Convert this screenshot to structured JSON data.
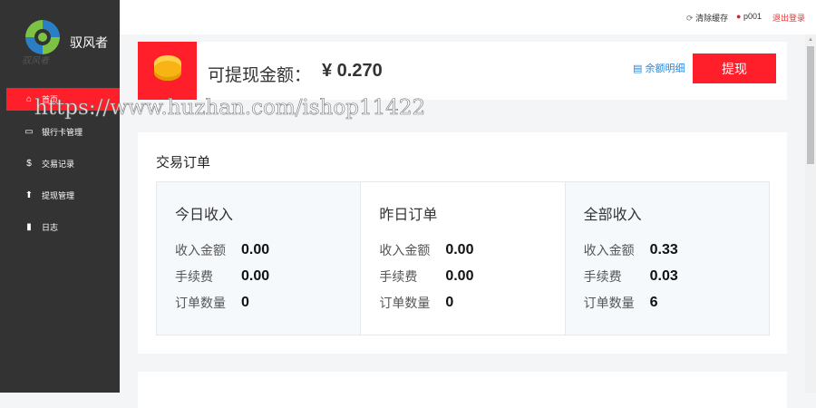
{
  "sidebar": {
    "brand": "驭风者",
    "logo_text": "驭风者",
    "items": [
      {
        "label": "首页",
        "icon": "home-icon"
      },
      {
        "label": "银行卡管理",
        "icon": "card-icon"
      },
      {
        "label": "交易记录",
        "icon": "dollar-icon"
      },
      {
        "label": "提现管理",
        "icon": "upload-icon"
      },
      {
        "label": "日志",
        "icon": "book-icon"
      }
    ]
  },
  "topbar": {
    "clear_cache": "清除缓存",
    "user": "p001",
    "logout": "退出登录"
  },
  "balance": {
    "label": "可提现金额：",
    "amount": "¥ 0.270",
    "detail_link": "余额明细",
    "withdraw_button": "提现"
  },
  "orders": {
    "title": "交易订单",
    "columns": [
      {
        "title": "今日收入",
        "rows": [
          {
            "k": "收入金额",
            "v": "0.00"
          },
          {
            "k": "手续费",
            "v": "0.00"
          },
          {
            "k": "订单数量",
            "v": "0"
          }
        ]
      },
      {
        "title": "昨日订单",
        "rows": [
          {
            "k": "收入金额",
            "v": "0.00"
          },
          {
            "k": "手续费",
            "v": "0.00"
          },
          {
            "k": "订单数量",
            "v": "0"
          }
        ]
      },
      {
        "title": "全部收入",
        "rows": [
          {
            "k": "收入金额",
            "v": "0.33"
          },
          {
            "k": "手续费",
            "v": "0.03"
          },
          {
            "k": "订单数量",
            "v": "6"
          }
        ]
      }
    ]
  },
  "watermark": "https://www.huzhan.com/ishop11422",
  "colors": {
    "accent": "#ff1f2b",
    "sidebar": "#333333",
    "link": "#1e88e5"
  }
}
